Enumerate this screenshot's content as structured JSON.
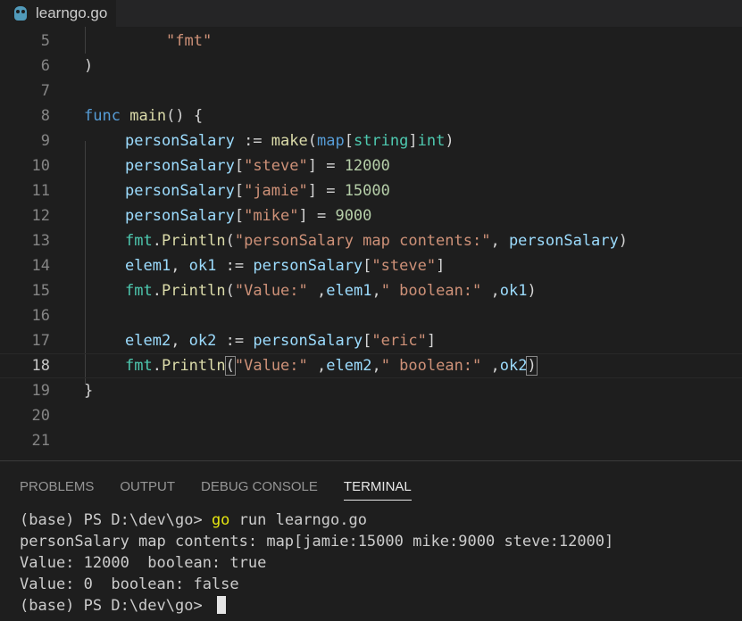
{
  "tab": {
    "filename": "learngo.go",
    "icon": "gopher-icon"
  },
  "editor": {
    "lines": [
      {
        "num": "5",
        "tokens": [
          [
            "str",
            "\"fmt\""
          ]
        ],
        "indent": 2
      },
      {
        "num": "6",
        "tokens": [
          [
            "pl",
            ")"
          ]
        ],
        "indent": 0
      },
      {
        "num": "7",
        "tokens": [],
        "indent": 0
      },
      {
        "num": "8",
        "tokens": [
          [
            "kw",
            "func"
          ],
          [
            "pl",
            " "
          ],
          [
            "fn",
            "main"
          ],
          [
            "pl",
            "() {"
          ]
        ],
        "indent": 0
      },
      {
        "num": "9",
        "tokens": [
          [
            "var",
            "personSalary"
          ],
          [
            "pl",
            " := "
          ],
          [
            "fn",
            "make"
          ],
          [
            "pl",
            "("
          ],
          [
            "kw",
            "map"
          ],
          [
            "pl",
            "["
          ],
          [
            "typ",
            "string"
          ],
          [
            "pl",
            "]"
          ],
          [
            "typ",
            "int"
          ],
          [
            "pl",
            ")"
          ]
        ],
        "indent": 1
      },
      {
        "num": "10",
        "tokens": [
          [
            "var",
            "personSalary"
          ],
          [
            "pl",
            "["
          ],
          [
            "str",
            "\"steve\""
          ],
          [
            "pl",
            "] = "
          ],
          [
            "num",
            "12000"
          ]
        ],
        "indent": 1
      },
      {
        "num": "11",
        "tokens": [
          [
            "var",
            "personSalary"
          ],
          [
            "pl",
            "["
          ],
          [
            "str",
            "\"jamie\""
          ],
          [
            "pl",
            "] = "
          ],
          [
            "num",
            "15000"
          ]
        ],
        "indent": 1
      },
      {
        "num": "12",
        "tokens": [
          [
            "var",
            "personSalary"
          ],
          [
            "pl",
            "["
          ],
          [
            "str",
            "\"mike\""
          ],
          [
            "pl",
            "] = "
          ],
          [
            "num",
            "9000"
          ]
        ],
        "indent": 1
      },
      {
        "num": "13",
        "tokens": [
          [
            "typ",
            "fmt"
          ],
          [
            "pl",
            "."
          ],
          [
            "fn",
            "Println"
          ],
          [
            "pl",
            "("
          ],
          [
            "str",
            "\"personSalary map contents:\""
          ],
          [
            "pl",
            ", "
          ],
          [
            "var",
            "personSalary"
          ],
          [
            "pl",
            ")"
          ]
        ],
        "indent": 1
      },
      {
        "num": "14",
        "tokens": [
          [
            "var",
            "elem1"
          ],
          [
            "pl",
            ", "
          ],
          [
            "var",
            "ok1"
          ],
          [
            "pl",
            " := "
          ],
          [
            "var",
            "personSalary"
          ],
          [
            "pl",
            "["
          ],
          [
            "str",
            "\"steve\""
          ],
          [
            "pl",
            "]"
          ]
        ],
        "indent": 1
      },
      {
        "num": "15",
        "tokens": [
          [
            "typ",
            "fmt"
          ],
          [
            "pl",
            "."
          ],
          [
            "fn",
            "Println"
          ],
          [
            "pl",
            "("
          ],
          [
            "str",
            "\"Value:\""
          ],
          [
            "pl",
            " ,"
          ],
          [
            "var",
            "elem1"
          ],
          [
            "pl",
            ","
          ],
          [
            "str",
            "\" boolean:\""
          ],
          [
            "pl",
            " ,"
          ],
          [
            "var",
            "ok1"
          ],
          [
            "pl",
            ")"
          ]
        ],
        "indent": 1
      },
      {
        "num": "16",
        "tokens": [],
        "indent": 0
      },
      {
        "num": "17",
        "tokens": [
          [
            "var",
            "elem2"
          ],
          [
            "pl",
            ", "
          ],
          [
            "var",
            "ok2"
          ],
          [
            "pl",
            " := "
          ],
          [
            "var",
            "personSalary"
          ],
          [
            "pl",
            "["
          ],
          [
            "str",
            "\"eric\""
          ],
          [
            "pl",
            "]"
          ]
        ],
        "indent": 1
      },
      {
        "num": "18",
        "tokens": [
          [
            "typ",
            "fmt"
          ],
          [
            "pl",
            "."
          ],
          [
            "fn",
            "Println"
          ],
          [
            "brk",
            "("
          ],
          [
            "str",
            "\"Value:\""
          ],
          [
            "pl",
            " ,"
          ],
          [
            "var",
            "elem2"
          ],
          [
            "pl",
            ","
          ],
          [
            "str",
            "\" boolean:\""
          ],
          [
            "pl",
            " ,"
          ],
          [
            "var",
            "ok2"
          ],
          [
            "brk",
            ")"
          ]
        ],
        "indent": 1,
        "current": true
      },
      {
        "num": "19",
        "tokens": [
          [
            "pl",
            "}"
          ]
        ],
        "indent": 0
      },
      {
        "num": "20",
        "tokens": [],
        "indent": 0
      },
      {
        "num": "21",
        "tokens": [],
        "indent": 0
      }
    ]
  },
  "panel": {
    "tabs": [
      "PROBLEMS",
      "OUTPUT",
      "DEBUG CONSOLE",
      "TERMINAL"
    ],
    "active_tab": "TERMINAL"
  },
  "terminal": {
    "prompt": "(base) PS D:\\dev\\go> ",
    "command_go": "go",
    "command_rest": " run learngo.go",
    "output": [
      "personSalary map contents: map[jamie:15000 mike:9000 steve:12000]",
      "Value: 12000  boolean: true",
      "Value: 0  boolean: false"
    ],
    "final_prompt": "(base) PS D:\\dev\\go> "
  }
}
